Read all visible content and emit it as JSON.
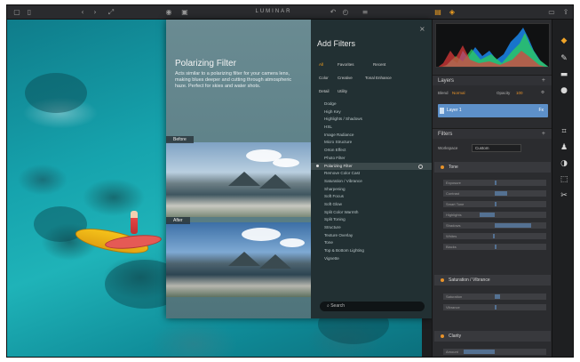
{
  "app": {
    "title": "LUMINAR"
  },
  "overlay": {
    "filter_title": "Polarizing Filter",
    "filter_description": "Acts similar to a polarizing filter for your camera lens, making blues deeper and cutting through atmospheric haze. Perfect for skies and water shots.",
    "before_label": "Before",
    "after_label": "After",
    "panel_title": "Add Filters",
    "close_glyph": "×",
    "categories": [
      {
        "label": "All",
        "active": true
      },
      {
        "label": "Favorites",
        "active": false
      },
      {
        "label": "Recent",
        "active": false
      },
      {
        "label": "Color",
        "active": false
      },
      {
        "label": "Creative",
        "active": false
      },
      {
        "label": "Tonal Enhance",
        "active": false
      },
      {
        "label": "Detail",
        "active": false
      },
      {
        "label": "Utility",
        "active": false
      }
    ],
    "filters": [
      "Dodge",
      "High Key",
      "Highlights / Shadows",
      "HSL",
      "Image Radiance",
      "Micro Structure",
      "Orton Effect",
      "Photo Filter",
      "Polarizing Filter",
      "Remove Color Cast",
      "Saturation / Vibrance",
      "Sharpening",
      "Soft Focus",
      "Soft Glow",
      "Split Color Warmth",
      "Split Toning",
      "Structure",
      "Texture Overlay",
      "Tone",
      "Top & Bottom Lighting",
      "Vignette"
    ],
    "selected_filter": "Polarizing Filter",
    "search_label": "Search"
  },
  "right_panel": {
    "layers": {
      "title": "Layers",
      "blend_label": "Blend",
      "blend_value": "Normal",
      "opacity_label": "Opacity",
      "opacity_value": "100",
      "layer_name": "Layer 1",
      "fx_label": "Fx"
    },
    "filters": {
      "title": "Filters",
      "workspace_label": "Workspace",
      "workspace_value": "Custom",
      "sections": [
        {
          "title": "Tone",
          "sliders": [
            {
              "label": "Exposure",
              "value": 0.52
            },
            {
              "label": "Contrast",
              "value": 0.62
            },
            {
              "label": "Smart Tone",
              "value": 0.5
            },
            {
              "label": "Highlights",
              "value": 0.35
            },
            {
              "label": "Shadows",
              "value": 0.85
            },
            {
              "label": "Whites",
              "value": 0.48
            },
            {
              "label": "Blacks",
              "value": 0.52
            }
          ]
        },
        {
          "title": "Saturation / Vibrance",
          "sliders": [
            {
              "label": "Saturation",
              "value": 0.55
            },
            {
              "label": "Vibrance",
              "value": 0.5
            }
          ]
        },
        {
          "title": "Clarity",
          "sliders": [
            {
              "label": "Amount",
              "value": 0.2
            }
          ]
        }
      ]
    }
  },
  "colors": {
    "accent": "#f2a020",
    "layer_selected": "#5d90c9"
  }
}
